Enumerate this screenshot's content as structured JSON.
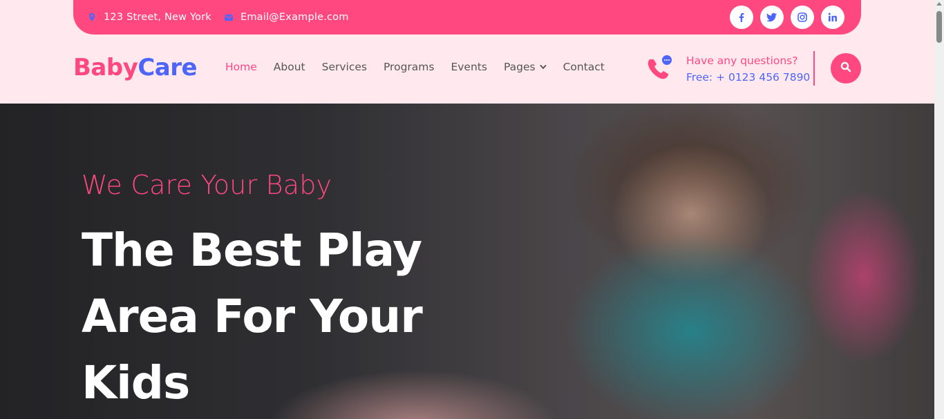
{
  "topbar": {
    "address": "123 Street, New York",
    "email": "Email@Example.com",
    "address_icon": "map-marker-icon",
    "email_icon": "envelope-icon",
    "socials": [
      {
        "name": "facebook",
        "glyph": "f"
      },
      {
        "name": "twitter",
        "glyph": "t"
      },
      {
        "name": "instagram",
        "glyph": "ig"
      },
      {
        "name": "linkedin",
        "glyph": "in"
      }
    ]
  },
  "brand": {
    "part1": "Baby",
    "part2": "Care"
  },
  "nav": {
    "items": [
      "Home",
      "About",
      "Services",
      "Programs",
      "Events",
      "Pages",
      "Contact"
    ],
    "active": "Home"
  },
  "contact": {
    "question": "Have any questions?",
    "phone": "Free: + 0123 456 7890",
    "icon": "phone-chat-icon"
  },
  "search": {
    "icon": "search-icon"
  },
  "hero": {
    "subtitle": "We Care Your Baby",
    "title": "The Best Play Area For Your Kids"
  },
  "colors": {
    "primary": "#ff4880",
    "secondary": "#4d65f9",
    "background": "#ffe9ef"
  }
}
